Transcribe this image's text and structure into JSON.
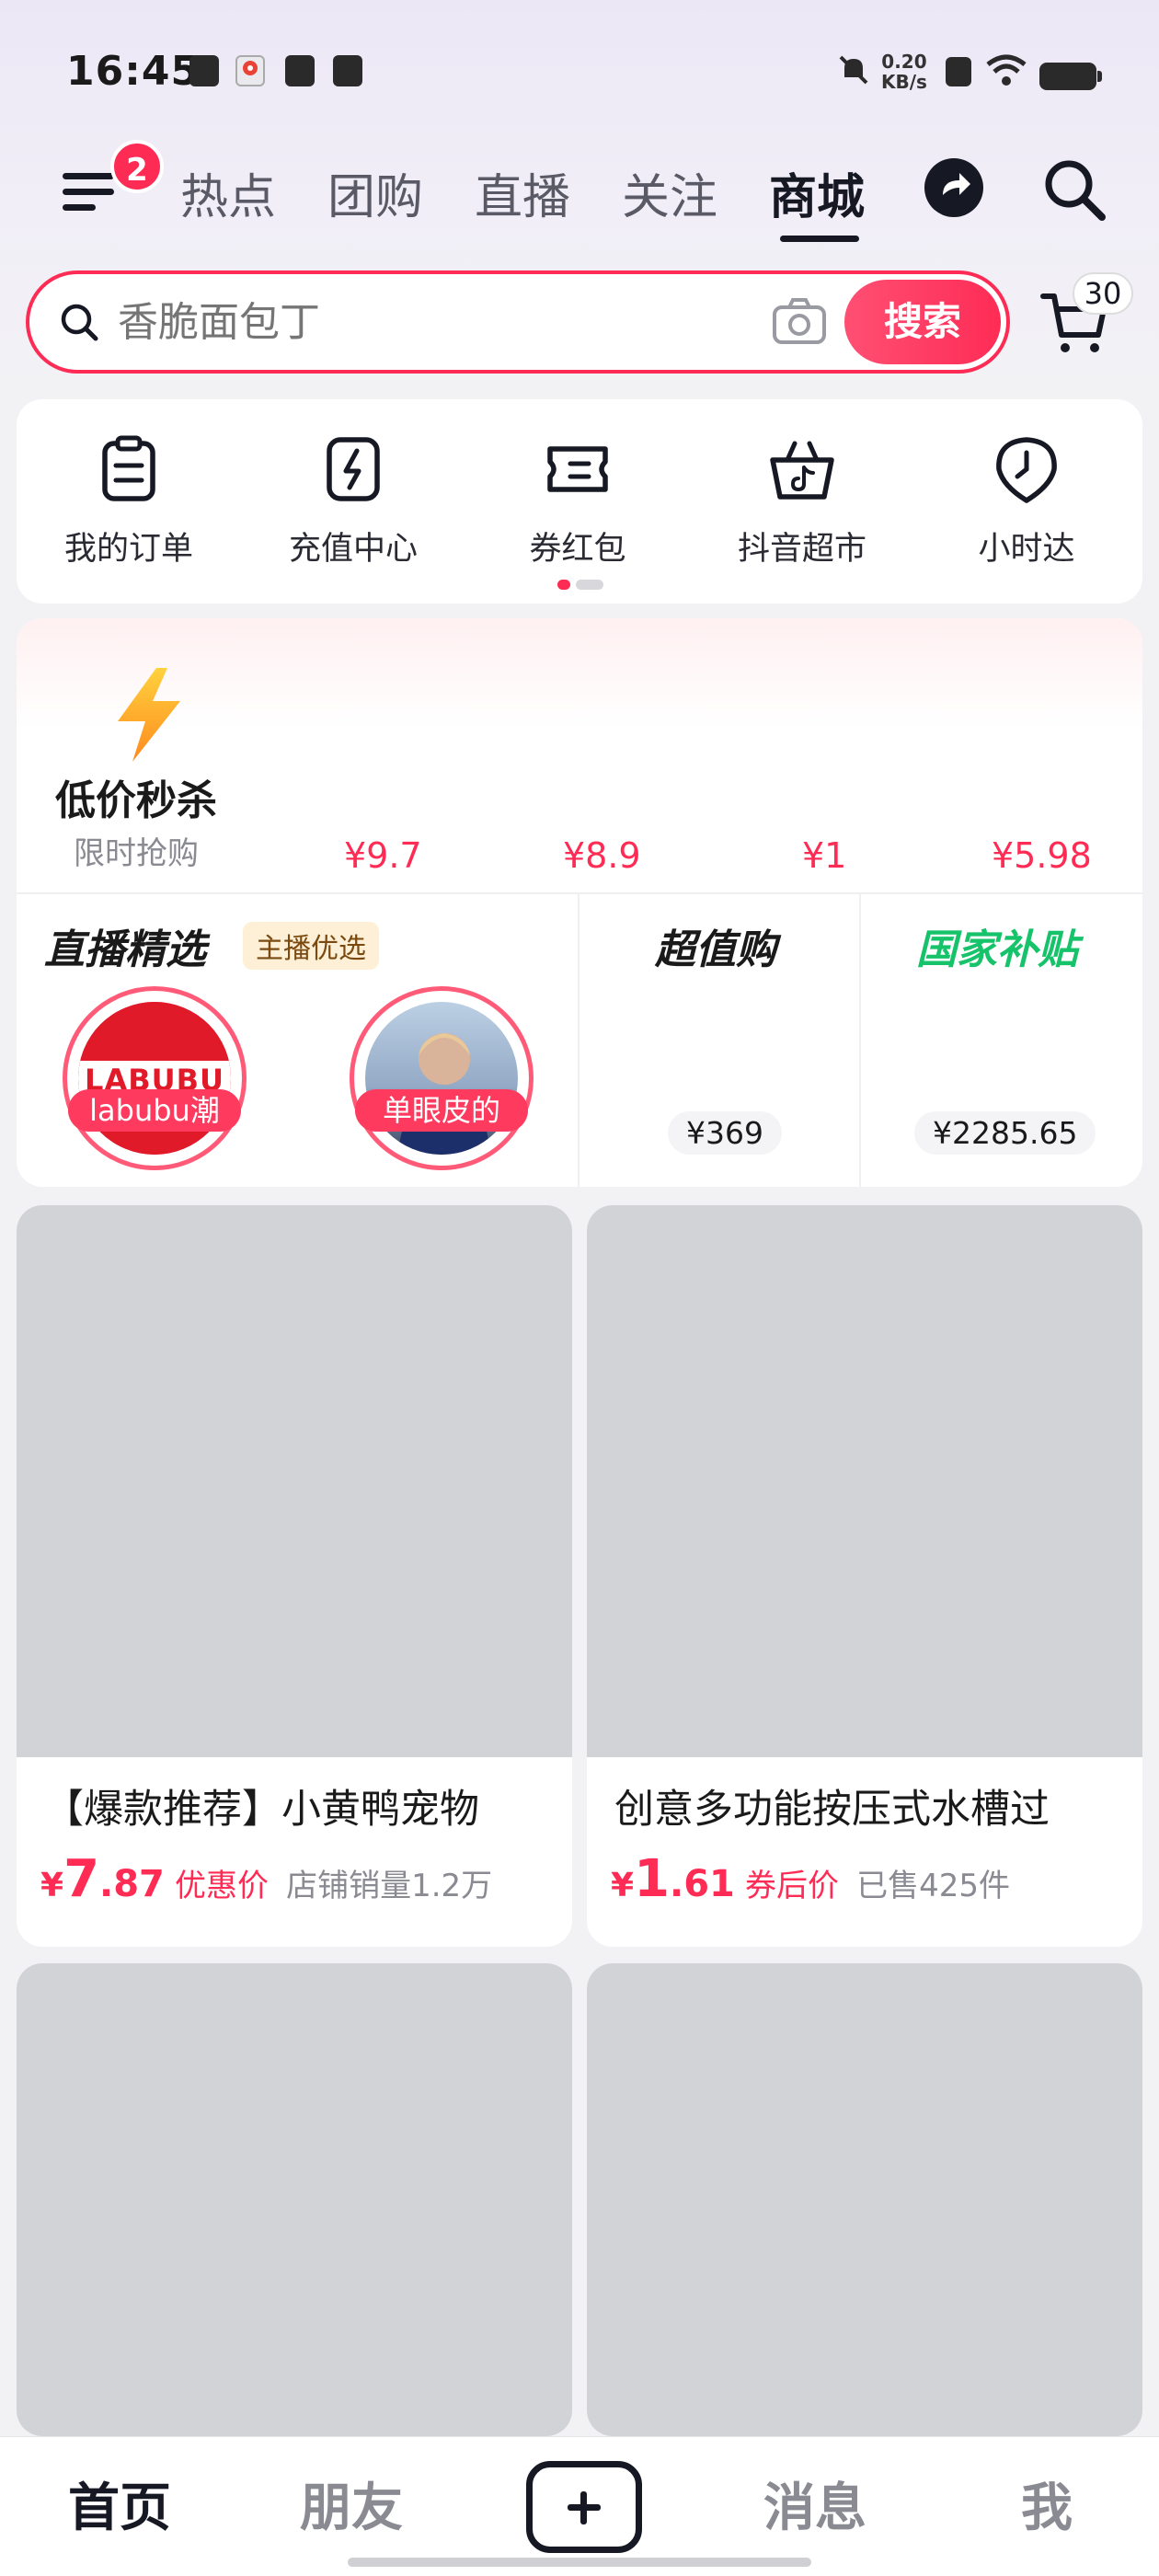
{
  "status_bar": {
    "time": "16:45",
    "net_speed_value": "0.20",
    "net_speed_unit": "KB/s"
  },
  "top_nav": {
    "menu_badge": "2",
    "tabs": [
      {
        "label": "热点",
        "active": false
      },
      {
        "label": "团购",
        "active": false
      },
      {
        "label": "直播",
        "active": false
      },
      {
        "label": "关注",
        "active": false
      },
      {
        "label": "商城",
        "active": true
      }
    ]
  },
  "search": {
    "placeholder": "香脆面包丁",
    "button_label": "搜索",
    "cart_count": "30"
  },
  "quick_menu": {
    "items": [
      {
        "label": "我的订单",
        "icon": "order-icon"
      },
      {
        "label": "充值中心",
        "icon": "recharge-icon"
      },
      {
        "label": "券红包",
        "icon": "coupon-icon"
      },
      {
        "label": "抖音超市",
        "icon": "basket-icon"
      },
      {
        "label": "小时达",
        "icon": "clock-icon"
      }
    ],
    "page_count": 2,
    "current_page": 1
  },
  "flash_sale": {
    "title": "低价秒杀",
    "subtitle": "限时抢购",
    "prices": [
      "¥9.7",
      "¥8.9",
      "¥1",
      "¥5.98"
    ]
  },
  "live_select": {
    "title": "直播精选",
    "tag": "主播优选",
    "anchors": [
      {
        "label": "labubu潮",
        "logo_text": "LABUBU"
      },
      {
        "label": "单眼皮的"
      }
    ]
  },
  "value_buy": {
    "title": "超值购",
    "price": "¥369"
  },
  "subsidy": {
    "title": "国家补贴",
    "price": "¥2285.65"
  },
  "products": [
    {
      "title": "【爆款推荐】小黄鸭宠物",
      "yen": "¥",
      "price_int": "7",
      "price_dec": ".87",
      "price_tag": "优惠价",
      "sales": "店铺销量1.2万"
    },
    {
      "title": "创意多功能按压式水槽过",
      "yen": "¥",
      "price_int": "1",
      "price_dec": ".61",
      "price_tag": "券后价",
      "sales": "已售425件"
    }
  ],
  "bottom_nav": {
    "tabs": [
      {
        "label": "首页",
        "active": true
      },
      {
        "label": "朋友",
        "active": false
      },
      {
        "label": "消息",
        "active": false
      },
      {
        "label": "我",
        "active": false
      }
    ]
  },
  "colors": {
    "accent": "#fe2c55",
    "subsidy_green": "#16c36a",
    "placeholder_gray": "#d2d3d7"
  }
}
